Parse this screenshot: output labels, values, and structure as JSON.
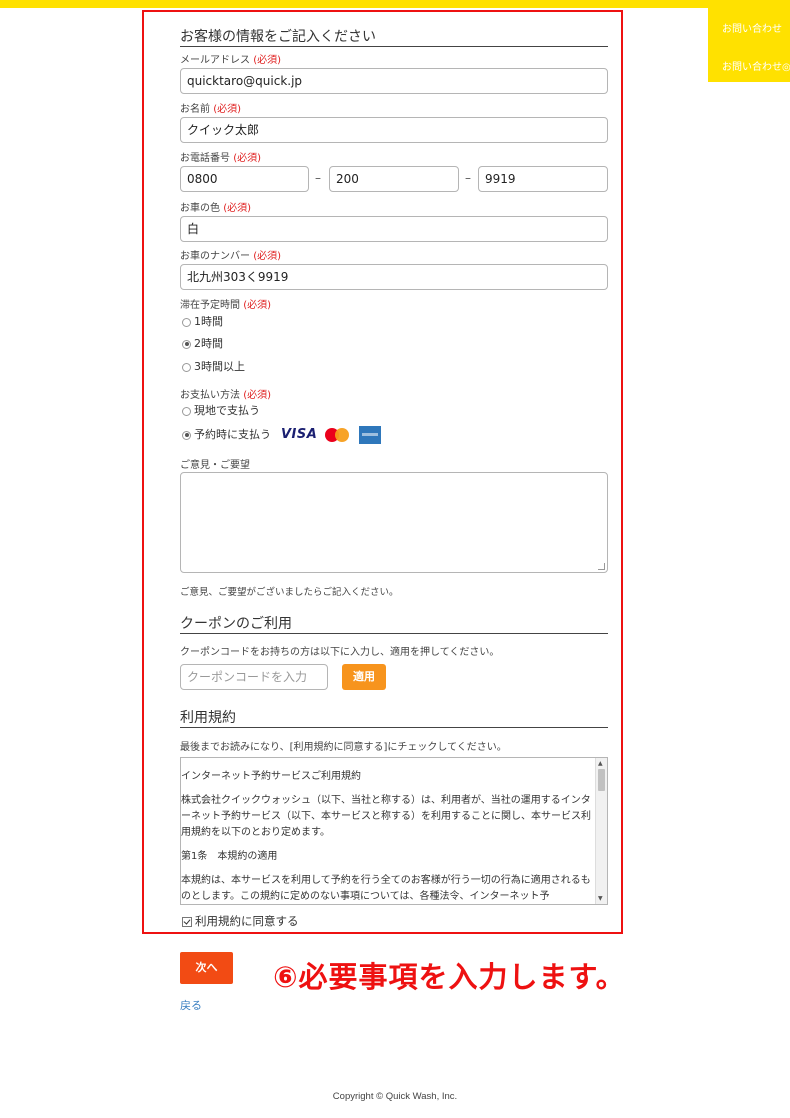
{
  "side_nav": {
    "items": [
      "お問い合わせ",
      "お問い合わせ◎"
    ],
    "color": "#ffe100"
  },
  "customer": {
    "section_title": "お客様の情報をご記入ください",
    "required_mark": "(必須)",
    "email": {
      "label": "メールアドレス",
      "value": "quicktaro@quick.jp"
    },
    "name": {
      "label": "お名前",
      "value": "クイック太郎"
    },
    "phone": {
      "label": "お電話番号",
      "part1": "0800",
      "part2": "200",
      "part3": "9919",
      "separator": "–"
    },
    "car_color": {
      "label": "お車の色",
      "value": "白"
    },
    "car_number": {
      "label": "お車のナンバー",
      "value": "北九州303く9919"
    },
    "stay_time": {
      "label": "滞在予定時間",
      "options": [
        "1時間",
        "2時間",
        "3時間以上"
      ],
      "selected": "2時間"
    },
    "payment": {
      "label": "お支払い方法",
      "options": [
        "現地で支払う",
        "予約時に支払う"
      ],
      "selected": "予約時に支払う",
      "card_brands": [
        "VISA",
        "mastercard",
        "amex"
      ]
    },
    "comment": {
      "label": "ご意見・ご要望",
      "value": "",
      "hint": "ご意見、ご要望がございましたらご記入ください。"
    }
  },
  "coupon": {
    "section_title": "クーポンのご利用",
    "description": "クーポンコードをお持ちの方は以下に入力し、適用を押してください。",
    "placeholder": "クーポンコードを入力",
    "apply_label": "適用"
  },
  "terms": {
    "section_title": "利用規約",
    "instruction": "最後までお読みになり、[利用規約に同意する]にチェックしてください。",
    "paragraphs": [
      "インターネット予約サービスご利用規約",
      "株式会社クイックウォッシュ（以下、当社と称する）は、利用者が、当社の運用するインターネット予約サービス（以下、本サービスと称する）を利用することに関し、本サービス利用規約を以下のとおり定めます。",
      "第1条　本規約の適用",
      "本規約は、本サービスを利用して予約を行う全てのお客様が行う一切の行為に適用されるものとします。この規約に定めのない事項については、各種法令、インターネット予"
    ],
    "agree_label": "利用規約に同意する",
    "agreed": true
  },
  "actions": {
    "next_label": "次へ",
    "back_label": "戻る"
  },
  "annotation": "⑥必要事項を入力します。",
  "footer": {
    "copyright": "Copyright © Quick Wash, Inc."
  },
  "colors": {
    "brand_yellow": "#ffe100",
    "highlight_red": "#ee1111",
    "required_red": "#e02020",
    "apply_orange": "#f7941d",
    "next_orange": "#f24b14",
    "link_blue": "#3a7fc1"
  }
}
